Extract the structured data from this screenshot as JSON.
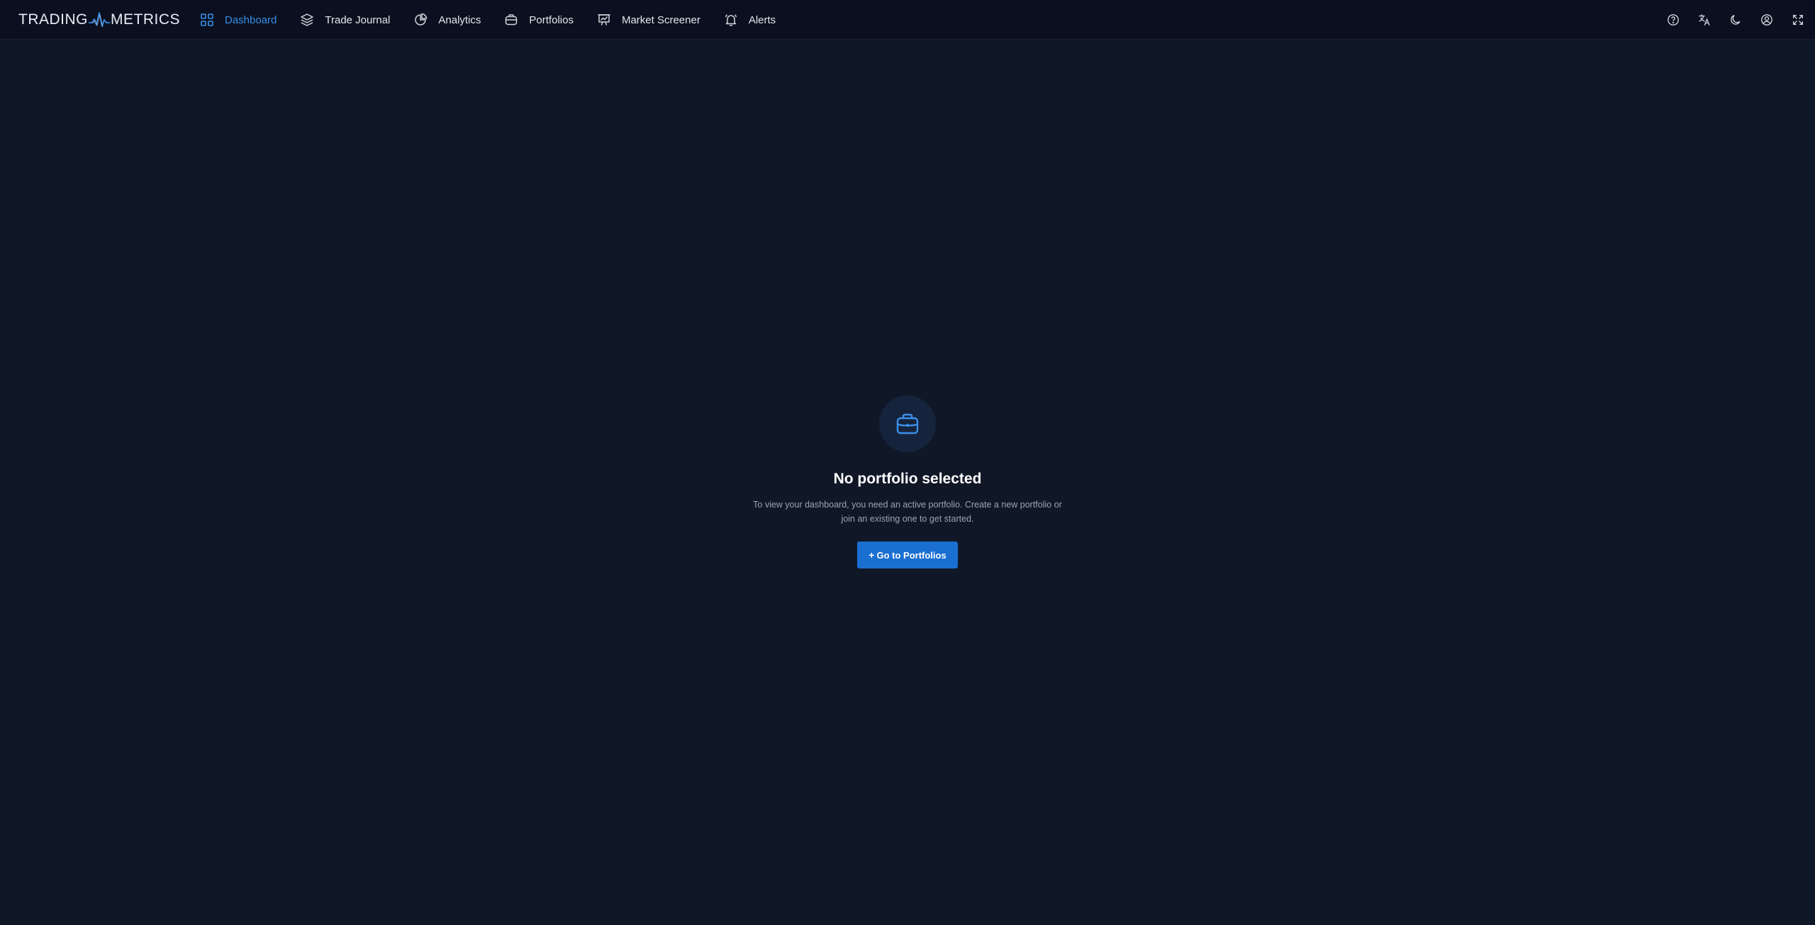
{
  "logo": {
    "left": "TRADING",
    "right": "METRICS"
  },
  "nav": {
    "items": [
      {
        "label": "Dashboard",
        "icon": "grid-icon",
        "active": true
      },
      {
        "label": "Trade Journal",
        "icon": "layers-icon",
        "active": false
      },
      {
        "label": "Analytics",
        "icon": "pie-chart-icon",
        "active": false
      },
      {
        "label": "Portfolios",
        "icon": "briefcase-icon",
        "active": false
      },
      {
        "label": "Market Screener",
        "icon": "presentation-chart-icon",
        "active": false
      },
      {
        "label": "Alerts",
        "icon": "bell-icon",
        "active": false
      }
    ]
  },
  "toolbar": {
    "icons": [
      "help-icon",
      "translate-icon",
      "moon-icon",
      "user-icon",
      "fullscreen-icon"
    ]
  },
  "empty_state": {
    "icon": "briefcase-icon",
    "title": "No portfolio selected",
    "description": "To view your dashboard, you need an active portfolio. Create a new portfolio or join an existing one to get started.",
    "button_icon": "+",
    "button_label": "Go to Portfolios"
  },
  "colors": {
    "background": "#101828",
    "topbar": "#0a1020",
    "accent": "#3b8fe8",
    "button": "#1a6fd1"
  }
}
